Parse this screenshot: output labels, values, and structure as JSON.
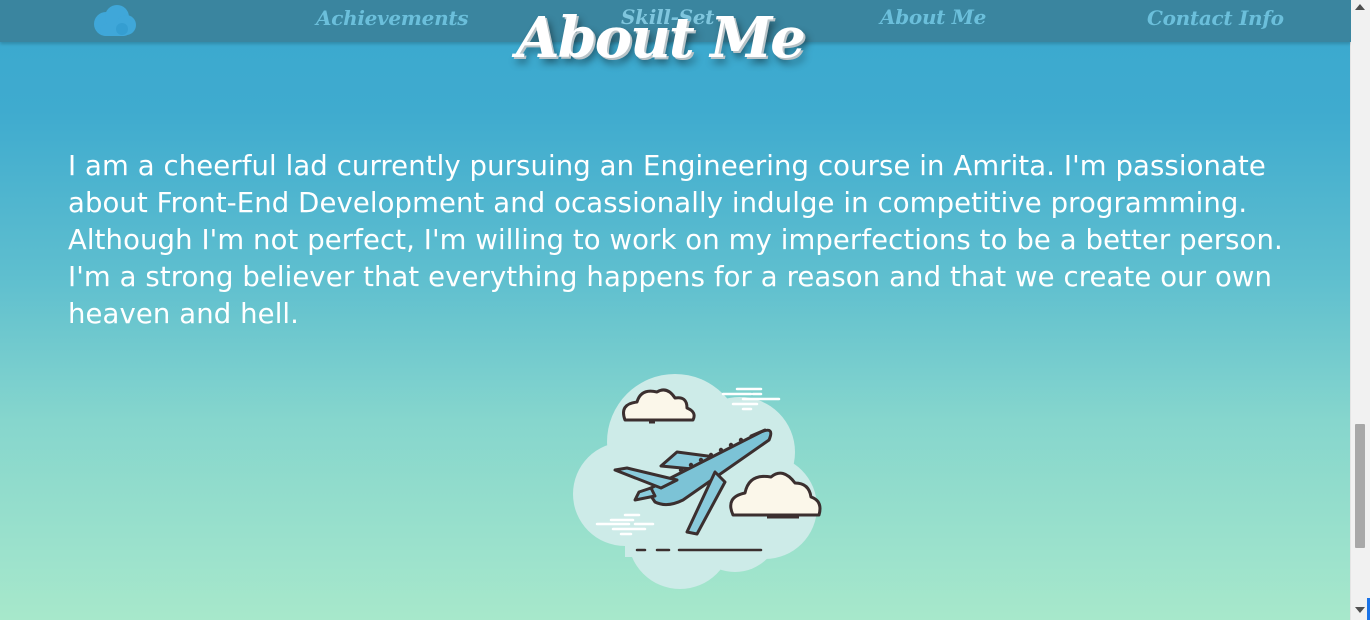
{
  "nav": {
    "logo_icon": "cloud-icon",
    "links": [
      {
        "label": "Achievements"
      },
      {
        "label": "Skill-Set"
      },
      {
        "label": "About Me"
      },
      {
        "label": "Contact Info"
      }
    ]
  },
  "section": {
    "title": "About Me",
    "text": "I am a cheerful lad currently pursuing an Engineering course in Amrita. I'm passionate about Front-End Development and ocassionally indulge in competitive programming. Although I'm not perfect, I'm willing to work on my imperfections to be a better person. I'm a strong believer that everything happens for a reason and that we create our own heaven and hell."
  },
  "illustration": {
    "icon": "airplane-clouds-icon"
  },
  "colors": {
    "nav_bg": "#3a859f",
    "nav_text": "#6bbfdb",
    "gradient_top": "#3aa8cf",
    "gradient_bottom": "#a7e8cb",
    "plane_body": "#7cc3d6",
    "outline": "#3b2f2f",
    "cloud": "#fbf7ea"
  },
  "scrollbar": {
    "position_fraction": 0.78
  }
}
